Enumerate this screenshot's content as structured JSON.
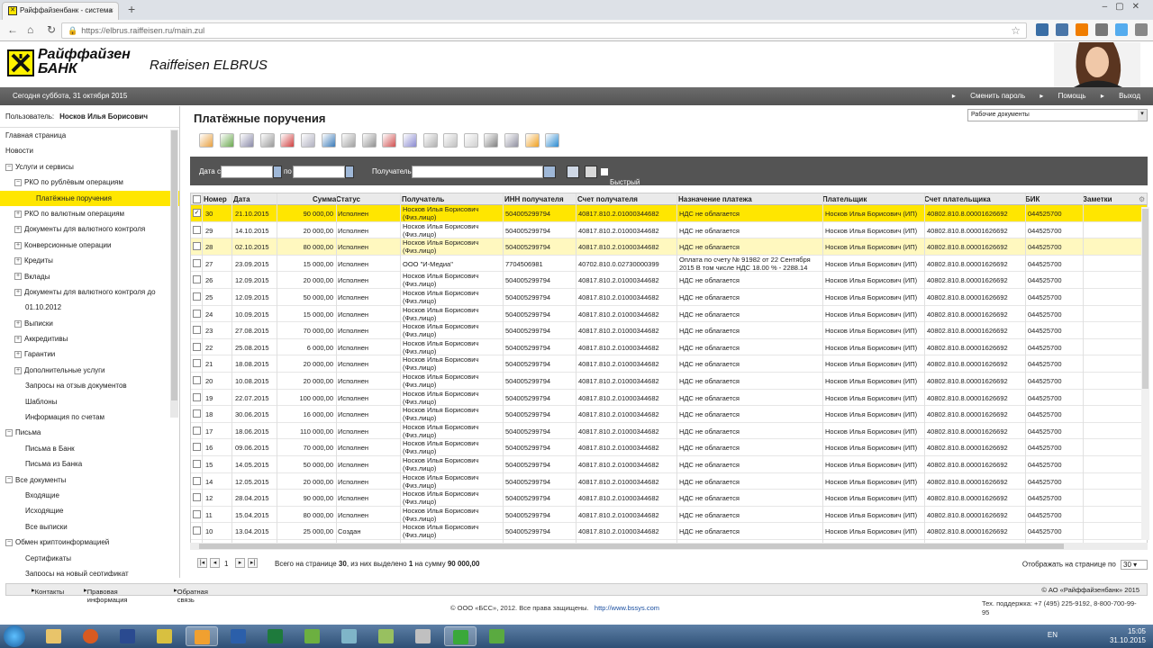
{
  "browser": {
    "tab_title": "Райффайзенбанк - система",
    "url": "https://elbrus.raiffeisen.ru/main.zul"
  },
  "bank": {
    "name_line1": "Райффайзен",
    "name_line2": "БАНК",
    "product": "Raiffeisen ELBRUS"
  },
  "topbar": {
    "date": "Сегодня суббота, 31 октября 2015",
    "change_password": "Сменить пароль",
    "help": "Помощь",
    "logout": "Выход"
  },
  "user": {
    "label": "Пользователь:",
    "name": "Носков Илья Борисович"
  },
  "menu": [
    {
      "label": "Главная страница",
      "level": 0,
      "toggle": ""
    },
    {
      "label": "Новости",
      "level": 0,
      "toggle": ""
    },
    {
      "label": "Услуги и сервисы",
      "level": 0,
      "toggle": "−"
    },
    {
      "label": "РКО по рублёвым операциям",
      "level": 1,
      "toggle": "−"
    },
    {
      "label": "Платёжные поручения",
      "level": 2,
      "toggle": "",
      "selected": true
    },
    {
      "label": "РКО по валютным операциям",
      "level": 1,
      "toggle": "+"
    },
    {
      "label": "Документы для валютного контроля",
      "level": 1,
      "toggle": "+"
    },
    {
      "label": "Конверсионные операции",
      "level": 1,
      "toggle": "+"
    },
    {
      "label": "Кредиты",
      "level": 1,
      "toggle": "+"
    },
    {
      "label": "Вклады",
      "level": 1,
      "toggle": "+"
    },
    {
      "label": "Документы для валютного контроля до",
      "level": 1,
      "toggle": "+"
    },
    {
      "label": "01.10.2012",
      "level": 1,
      "toggle": ""
    },
    {
      "label": "Выписки",
      "level": 1,
      "toggle": "+"
    },
    {
      "label": "Аккредитивы",
      "level": 1,
      "toggle": "+"
    },
    {
      "label": "Гарантии",
      "level": 1,
      "toggle": "+"
    },
    {
      "label": "Дополнительные услуги",
      "level": 1,
      "toggle": "+"
    },
    {
      "label": "Запросы на отзыв документов",
      "level": 1,
      "toggle": ""
    },
    {
      "label": "Шаблоны",
      "level": 1,
      "toggle": ""
    },
    {
      "label": "Информация по счетам",
      "level": 1,
      "toggle": ""
    },
    {
      "label": "Письма",
      "level": 0,
      "toggle": "−"
    },
    {
      "label": "Письма в Банк",
      "level": 1,
      "toggle": ""
    },
    {
      "label": "Письма из Банка",
      "level": 1,
      "toggle": ""
    },
    {
      "label": "Все документы",
      "level": 0,
      "toggle": "−"
    },
    {
      "label": "Входящие",
      "level": 1,
      "toggle": ""
    },
    {
      "label": "Исходящие",
      "level": 1,
      "toggle": ""
    },
    {
      "label": "Все выписки",
      "level": 1,
      "toggle": ""
    },
    {
      "label": "Обмен криптоинформацией",
      "level": 0,
      "toggle": "−"
    },
    {
      "label": "Сертификаты",
      "level": 1,
      "toggle": ""
    },
    {
      "label": "Запросы на новый сертификат",
      "level": 1,
      "toggle": ""
    }
  ],
  "page": {
    "title": "Платёжные поручения",
    "doc_select": "Рабочие документы"
  },
  "filter": {
    "date_from": "Дата с",
    "date_to": "по",
    "recipient": "Получатель",
    "quick_view": "Быстрый просмотр"
  },
  "columns": [
    "Номер",
    "Дата",
    "Сумма",
    "Статус",
    "Получатель",
    "ИНН получателя",
    "Счет получателя",
    "Назначение платежа",
    "Плательщик",
    "Счет плательщика",
    "БИК",
    "Заметки"
  ],
  "rows": [
    {
      "num": "30",
      "date": "21.10.2015",
      "sum": "90 000,00",
      "status": "Исполнен",
      "rec1": "Носков Илья Борисович",
      "rec2": "(Физ.лицо)",
      "inn": "504005299794",
      "acc": "40817.810.2.01000344682",
      "purp1": "НДС не облагается",
      "purp2": "",
      "payer": "Носков Илья Борисович (ИП)",
      "pacc": "40802.810.8.00001626692",
      "bik": "044525700",
      "checked": "✓"
    },
    {
      "num": "29",
      "date": "14.10.2015",
      "sum": "20 000,00",
      "status": "Исполнен",
      "rec1": "Носков Илья Борисович",
      "rec2": "(Физ.лицо)",
      "inn": "504005299794",
      "acc": "40817.810.2.01000344682",
      "purp1": "НДС не облагается",
      "purp2": "",
      "payer": "Носков Илья Борисович (ИП)",
      "pacc": "40802.810.8.00001626692",
      "bik": "044525700",
      "checked": ""
    },
    {
      "num": "28",
      "date": "02.10.2015",
      "sum": "80 000,00",
      "status": "Исполнен",
      "rec1": "Носков Илья Борисович",
      "rec2": "(Физ.лицо)",
      "inn": "504005299794",
      "acc": "40817.810.2.01000344682",
      "purp1": "НДС не облагается",
      "purp2": "",
      "payer": "Носков Илья Борисович (ИП)",
      "pacc": "40802.810.8.00001626692",
      "bik": "044525700",
      "checked": ""
    },
    {
      "num": "27",
      "date": "23.09.2015",
      "sum": "15 000,00",
      "status": "Исполнен",
      "rec1": "ООО \"И-Медиа\"",
      "rec2": "",
      "inn": "7704506981",
      "acc": "40702.810.0.02730000399",
      "purp1": "Оплата по счету № 91982 от 22 Сентября",
      "purp2": "2015 В том числе НДС 18.00 % - 2288.14",
      "payer": "Носков Илья Борисович (ИП)",
      "pacc": "40802.810.8.00001626692",
      "bik": "044525700",
      "checked": ""
    },
    {
      "num": "26",
      "date": "12.09.2015",
      "sum": "20 000,00",
      "status": "Исполнен",
      "rec1": "Носков Илья Борисович",
      "rec2": "(Физ.лицо)",
      "inn": "504005299794",
      "acc": "40817.810.2.01000344682",
      "purp1": "НДС не облагается",
      "purp2": "",
      "payer": "Носков Илья Борисович (ИП)",
      "pacc": "40802.810.8.00001626692",
      "bik": "044525700",
      "checked": ""
    },
    {
      "num": "25",
      "date": "12.09.2015",
      "sum": "50 000,00",
      "status": "Исполнен",
      "rec1": "Носков Илья Борисович",
      "rec2": "(Физ.лицо)",
      "inn": "504005299794",
      "acc": "40817.810.2.01000344682",
      "purp1": "НДС не облагается",
      "purp2": "",
      "payer": "Носков Илья Борисович (ИП)",
      "pacc": "40802.810.8.00001626692",
      "bik": "044525700",
      "checked": ""
    },
    {
      "num": "24",
      "date": "10.09.2015",
      "sum": "15 000,00",
      "status": "Исполнен",
      "rec1": "Носков Илья Борисович",
      "rec2": "(Физ.лицо)",
      "inn": "504005299794",
      "acc": "40817.810.2.01000344682",
      "purp1": "НДС не облагается",
      "purp2": "",
      "payer": "Носков Илья Борисович (ИП)",
      "pacc": "40802.810.8.00001626692",
      "bik": "044525700",
      "checked": ""
    },
    {
      "num": "23",
      "date": "27.08.2015",
      "sum": "70 000,00",
      "status": "Исполнен",
      "rec1": "Носков Илья Борисович",
      "rec2": "(Физ.лицо)",
      "inn": "504005299794",
      "acc": "40817.810.2.01000344682",
      "purp1": "НДС не облагается",
      "purp2": "",
      "payer": "Носков Илья Борисович (ИП)",
      "pacc": "40802.810.8.00001626692",
      "bik": "044525700",
      "checked": ""
    },
    {
      "num": "22",
      "date": "25.08.2015",
      "sum": "6 000,00",
      "status": "Исполнен",
      "rec1": "Носков Илья Борисович",
      "rec2": "(Физ.лицо)",
      "inn": "504005299794",
      "acc": "40817.810.2.01000344682",
      "purp1": "НДС не облагается",
      "purp2": "",
      "payer": "Носков Илья Борисович (ИП)",
      "pacc": "40802.810.8.00001626692",
      "bik": "044525700",
      "checked": ""
    },
    {
      "num": "21",
      "date": "18.08.2015",
      "sum": "20 000,00",
      "status": "Исполнен",
      "rec1": "Носков Илья Борисович",
      "rec2": "(Физ.лицо)",
      "inn": "504005299794",
      "acc": "40817.810.2.01000344682",
      "purp1": "НДС не облагается",
      "purp2": "",
      "payer": "Носков Илья Борисович (ИП)",
      "pacc": "40802.810.8.00001626692",
      "bik": "044525700",
      "checked": ""
    },
    {
      "num": "20",
      "date": "10.08.2015",
      "sum": "20 000,00",
      "status": "Исполнен",
      "rec1": "Носков Илья Борисович",
      "rec2": "(Физ.лицо)",
      "inn": "504005299794",
      "acc": "40817.810.2.01000344682",
      "purp1": "НДС не облагается",
      "purp2": "",
      "payer": "Носков Илья Борисович (ИП)",
      "pacc": "40802.810.8.00001626692",
      "bik": "044525700",
      "checked": ""
    },
    {
      "num": "19",
      "date": "22.07.2015",
      "sum": "100 000,00",
      "status": "Исполнен",
      "rec1": "Носков Илья Борисович",
      "rec2": "(Физ.лицо)",
      "inn": "504005299794",
      "acc": "40817.810.2.01000344682",
      "purp1": "НДС не облагается",
      "purp2": "",
      "payer": "Носков Илья Борисович (ИП)",
      "pacc": "40802.810.8.00001626692",
      "bik": "044525700",
      "checked": ""
    },
    {
      "num": "18",
      "date": "30.06.2015",
      "sum": "16 000,00",
      "status": "Исполнен",
      "rec1": "Носков Илья Борисович",
      "rec2": "(Физ.лицо)",
      "inn": "504005299794",
      "acc": "40817.810.2.01000344682",
      "purp1": "НДС не облагается",
      "purp2": "",
      "payer": "Носков Илья Борисович (ИП)",
      "pacc": "40802.810.8.00001626692",
      "bik": "044525700",
      "checked": ""
    },
    {
      "num": "17",
      "date": "18.06.2015",
      "sum": "110 000,00",
      "status": "Исполнен",
      "rec1": "Носков Илья Борисович",
      "rec2": "(Физ.лицо)",
      "inn": "504005299794",
      "acc": "40817.810.2.01000344682",
      "purp1": "НДС не облагается",
      "purp2": "",
      "payer": "Носков Илья Борисович (ИП)",
      "pacc": "40802.810.8.00001626692",
      "bik": "044525700",
      "checked": ""
    },
    {
      "num": "16",
      "date": "09.06.2015",
      "sum": "70 000,00",
      "status": "Исполнен",
      "rec1": "Носков Илья Борисович",
      "rec2": "(Физ.лицо)",
      "inn": "504005299794",
      "acc": "40817.810.2.01000344682",
      "purp1": "НДС не облагается",
      "purp2": "",
      "payer": "Носков Илья Борисович (ИП)",
      "pacc": "40802.810.8.00001626692",
      "bik": "044525700",
      "checked": ""
    },
    {
      "num": "15",
      "date": "14.05.2015",
      "sum": "50 000,00",
      "status": "Исполнен",
      "rec1": "Носков Илья Борисович",
      "rec2": "(Физ.лицо)",
      "inn": "504005299794",
      "acc": "40817.810.2.01000344682",
      "purp1": "НДС не облагается",
      "purp2": "",
      "payer": "Носков Илья Борисович (ИП)",
      "pacc": "40802.810.8.00001626692",
      "bik": "044525700",
      "checked": ""
    },
    {
      "num": "14",
      "date": "12.05.2015",
      "sum": "20 000,00",
      "status": "Исполнен",
      "rec1": "Носков Илья Борисович",
      "rec2": "(Физ.лицо)",
      "inn": "504005299794",
      "acc": "40817.810.2.01000344682",
      "purp1": "НДС не облагается",
      "purp2": "",
      "payer": "Носков Илья Борисович (ИП)",
      "pacc": "40802.810.8.00001626692",
      "bik": "044525700",
      "checked": ""
    },
    {
      "num": "12",
      "date": "28.04.2015",
      "sum": "90 000,00",
      "status": "Исполнен",
      "rec1": "Носков Илья Борисович",
      "rec2": "(Физ.лицо)",
      "inn": "504005299794",
      "acc": "40817.810.2.01000344682",
      "purp1": "НДС не облагается",
      "purp2": "",
      "payer": "Носков Илья Борисович (ИП)",
      "pacc": "40802.810.8.00001626692",
      "bik": "044525700",
      "checked": ""
    },
    {
      "num": "11",
      "date": "15.04.2015",
      "sum": "80 000,00",
      "status": "Исполнен",
      "rec1": "Носков Илья Борисович",
      "rec2": "(Физ.лицо)",
      "inn": "504005299794",
      "acc": "40817.810.2.01000344682",
      "purp1": "НДС не облагается",
      "purp2": "",
      "payer": "Носков Илья Борисович (ИП)",
      "pacc": "40802.810.8.00001626692",
      "bik": "044525700",
      "checked": ""
    },
    {
      "num": "10",
      "date": "13.04.2015",
      "sum": "25 000,00",
      "status": "Создан",
      "rec1": "Носков Илья Борисович",
      "rec2": "(Физ.лицо)",
      "inn": "504005299794",
      "acc": "40817.810.2.01000344682",
      "purp1": "НДС не облагается",
      "purp2": "",
      "payer": "Носков Илья Борисович (ИП)",
      "pacc": "40802.810.8.00001626692",
      "bik": "044525700",
      "checked": ""
    }
  ],
  "pager": {
    "page": "1",
    "summary_prefix": "Всего на странице",
    "total": "30",
    "summary_mid": ", из них выделено",
    "selected": "1",
    "summary_sum": "на сумму",
    "sum": "90 000,00",
    "per_page_label": "Отображать на странице по",
    "per_page": "30"
  },
  "footer": {
    "contacts": "Контакты",
    "legal": "Правовая информация",
    "feedback": "Обратная связь",
    "copyright_bank": "© АО «Райффайзенбанк» 2015",
    "copyright_bss": "© ООО «БСС», 2012. Все права защищены.",
    "bss_link": "http://www.bssys.com",
    "support_line1": "Тех. поддержка: +7 (495) 225-9192, 8-800-700-99-",
    "support_line2": "95"
  },
  "taskbar": {
    "lang": "EN",
    "time": "15:05",
    "date": "31.10.2015"
  },
  "colors": {
    "brand_yellow": "#ffe600",
    "dark_bar": "#545454"
  }
}
